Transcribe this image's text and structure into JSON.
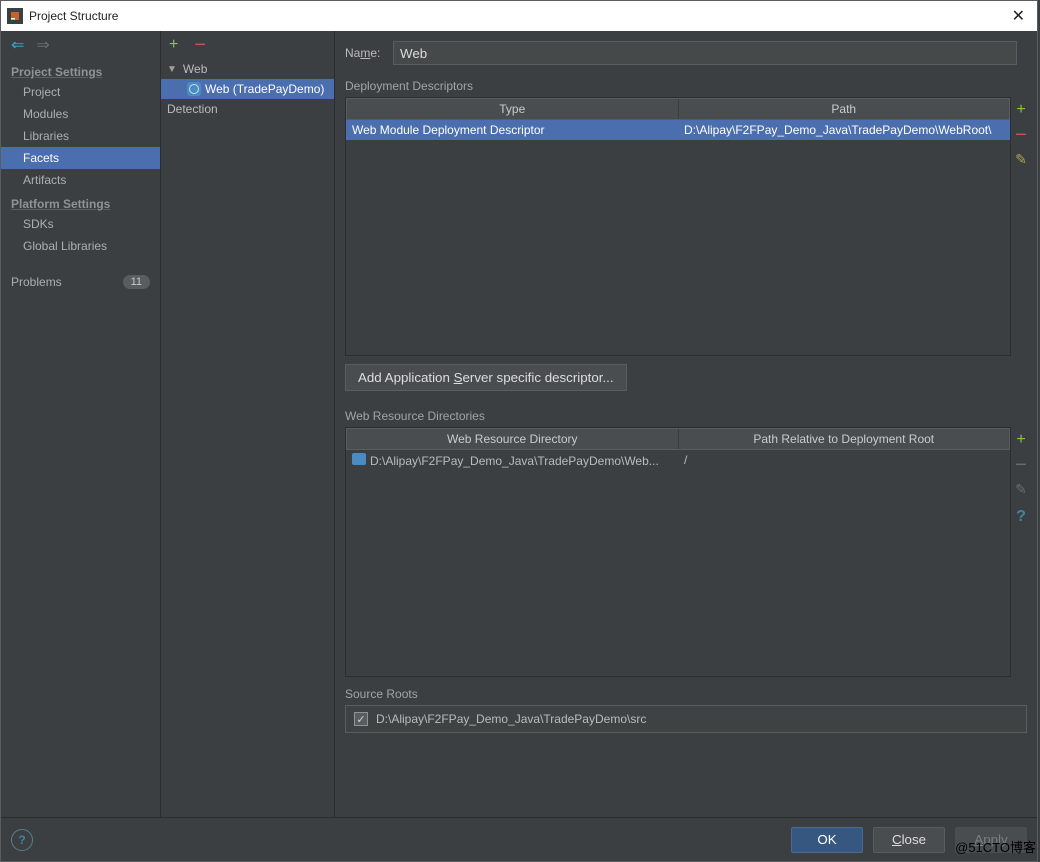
{
  "window": {
    "title": "Project Structure"
  },
  "sidebar": {
    "group1": "Project Settings",
    "items1": {
      "project": "Project",
      "modules": "Modules",
      "libraries": "Libraries",
      "facets": "Facets",
      "artifacts": "Artifacts"
    },
    "group2": "Platform Settings",
    "items2": {
      "sdks": "SDKs",
      "global": "Global Libraries"
    },
    "problems": {
      "label": "Problems",
      "count": "11"
    }
  },
  "tree": {
    "root": "Web",
    "child": "Web (TradePayDemo)",
    "detection": "Detection"
  },
  "main": {
    "name_label_pre": "Na",
    "name_label_u": "m",
    "name_label_post": "e:",
    "name_value": "Web",
    "deploy_section": "Deployment Descriptors",
    "deploy_headers": {
      "type": "Type",
      "path": "Path"
    },
    "deploy_row": {
      "type": "Web Module Deployment Descriptor",
      "path": "D:\\Alipay\\F2FPay_Demo_Java\\TradePayDemo\\WebRoot\\"
    },
    "add_desc_btn_pre": "Add Application ",
    "add_desc_btn_u": "S",
    "add_desc_btn_post": "erver specific descriptor...",
    "res_section": "Web Resource Directories",
    "res_headers": {
      "dir": "Web Resource Directory",
      "rel": "Path Relative to Deployment Root"
    },
    "res_row": {
      "dir": "D:\\Alipay\\F2FPay_Demo_Java\\TradePayDemo\\Web...",
      "rel": "/"
    },
    "src_section": "Source Roots",
    "src_path": "D:\\Alipay\\F2FPay_Demo_Java\\TradePayDemo\\src"
  },
  "buttons": {
    "ok": "OK",
    "close_u": "C",
    "close_post": "lose",
    "apply_u": "A",
    "apply_post": "pply"
  },
  "watermark": "@51CTO博客"
}
